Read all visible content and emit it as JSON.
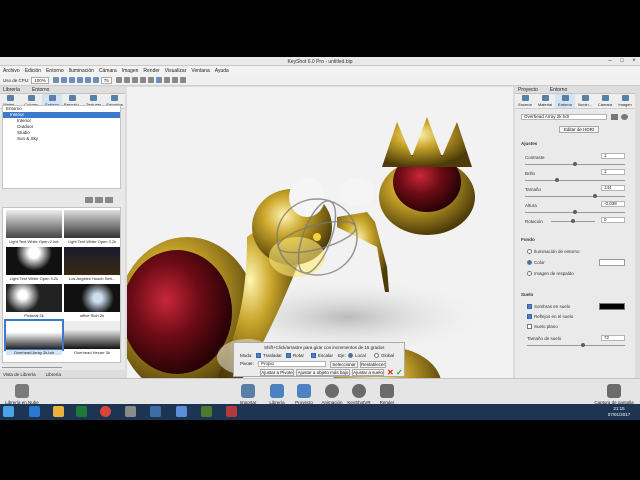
{
  "window": {
    "title": "KeyShot 6.0 Pro - untitled.bip"
  },
  "menu": [
    "Archivo",
    "Edición",
    "Entorno",
    "Iluminación",
    "Cámara",
    "Imagen",
    "Render",
    "Visualizar",
    "Ventana",
    "Ayuda"
  ],
  "toolbar": {
    "cpu_label": "Uso de CPU:",
    "cpu_value": "100%",
    "zoom_value": "75"
  },
  "left": {
    "header_tabs": [
      "Librería",
      "Entorno"
    ],
    "tabs": [
      "Materi...",
      "Colores",
      "Entorno",
      "Respald...",
      "Texturas",
      "Favoritos"
    ],
    "tree": [
      "Entorno",
      "Interior",
      "Interior",
      "Outdoor",
      "Studio",
      "Sun & Sky"
    ],
    "thumbs": [
      "Light Tent White Open 2.hdr",
      "Light Tent White Open 3.2k",
      "Light Tent White Open 3.2k",
      "Los Angeles Hooch Sett...",
      "Pictorial 2k",
      "office Rich 2k",
      "Overhead Array 2k.hdr",
      "Overhead Hexarr 3k"
    ],
    "footer_tabs": [
      "Vista de Librería",
      "Librería"
    ]
  },
  "right": {
    "header_tabs": [
      "Proyecto",
      "Entorno"
    ],
    "tabs": [
      "Escena",
      "Material",
      "Entorno",
      "Ilumin...",
      "Cámara",
      "Imagen"
    ],
    "env_name": "Overhead Array 2k.hdr",
    "edit_hdri": "Editar de HDRI",
    "section_adjust": "Ajustes",
    "adjust": [
      {
        "label": "Contraste",
        "value": "1"
      },
      {
        "label": "Brillo",
        "value": "1"
      },
      {
        "label": "Tamaño",
        "value": "144"
      },
      {
        "label": "Altura",
        "value": "-0,038"
      },
      {
        "label": "Rotación",
        "value": "0"
      }
    ],
    "section_bg": "Fondo",
    "bg_options": [
      "Iluminación de entorno",
      "Color",
      "Imagen de respaldo"
    ],
    "section_ground": "Suelo",
    "ground": [
      "Sombras en suelo",
      "Reflejos en el suelo",
      "Suelo plano"
    ],
    "ground_size_label": "Tamaño de suelo",
    "ground_size_value": "72"
  },
  "hud": {
    "hint": "Shift+Click/arrastre para girar con incrementos de 15 grados",
    "mode_label": "Modo:",
    "mode_opts": [
      "Trasladar",
      "Rotar",
      "Escalar"
    ],
    "axis_label": "Eje:",
    "axis_opts": [
      "Local",
      "Global"
    ],
    "pivot_label": "Pivote:",
    "pivot_value": "Propio",
    "select_btn": "Seleccionar",
    "reset_btn": "Restablecer",
    "btns": [
      "Ajustar a Pivote",
      "Ajustar a objeto más bajo",
      "Ajustar a suelo"
    ]
  },
  "bottom": {
    "items": [
      "Librería en Nube",
      "Importar",
      "Librería",
      "Proyecto",
      "Animación",
      "KeyShotVR",
      "Render"
    ],
    "screenshot": "Captura de pantalla"
  },
  "taskbar": {
    "time": "21:15",
    "date": "07/01/2017"
  },
  "colors": {
    "accent": "#3d79c9",
    "taskbar": "#1d3553"
  }
}
